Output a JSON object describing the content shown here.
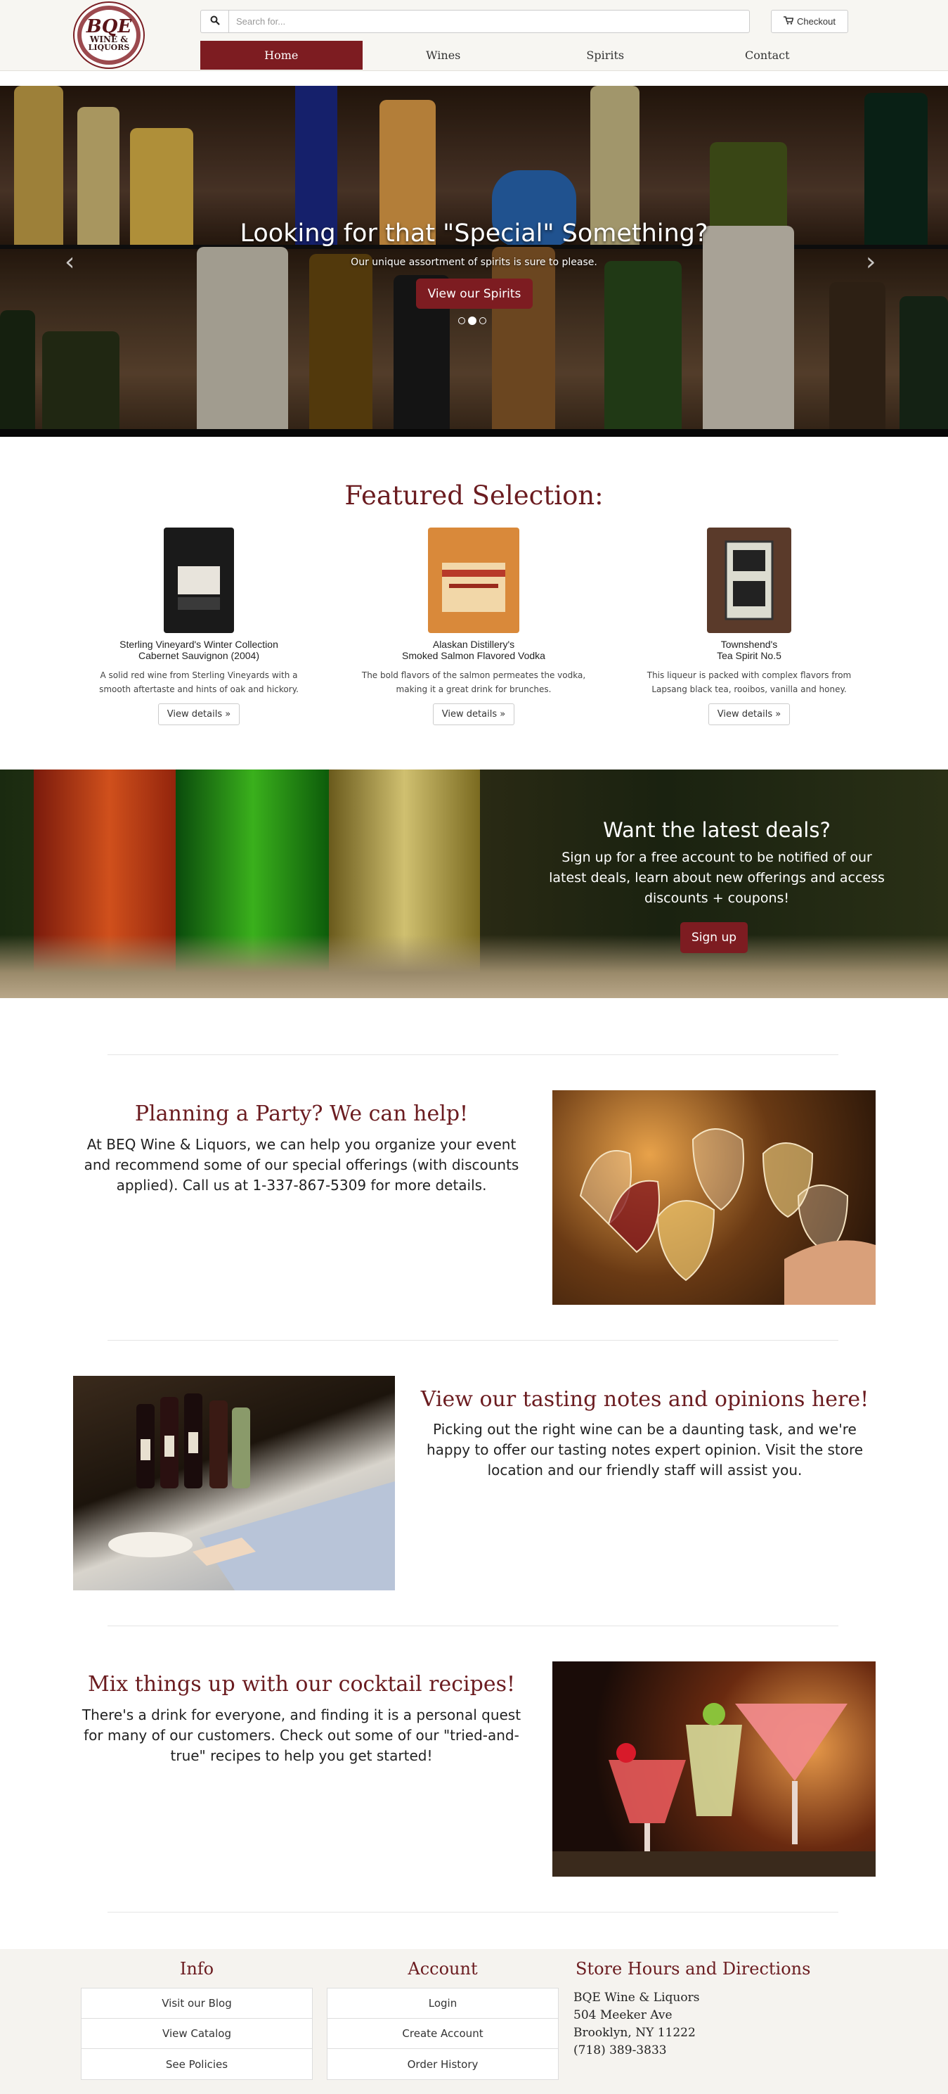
{
  "header": {
    "logo_line1": "BQE",
    "logo_line2": "WINE &",
    "logo_line3": "LIQUORS",
    "search_placeholder": "Search for...",
    "checkout_label": "Checkout"
  },
  "nav": {
    "items": [
      {
        "label": "Home",
        "active": true
      },
      {
        "label": "Wines",
        "active": false
      },
      {
        "label": "Spirits",
        "active": false
      },
      {
        "label": "Contact",
        "active": false
      }
    ]
  },
  "hero": {
    "title": "Looking for that \"Special\" Something?",
    "subtitle": "Our unique assortment of spirits is sure to please.",
    "button_label": "View our Spirits",
    "active_slide": 2,
    "slide_count": 3
  },
  "featured": {
    "title": "Featured Selection:",
    "products": [
      {
        "name_line1": "Sterling Vineyard's Winter Collection",
        "name_line2": "Cabernet Sauvignon (2004)",
        "description": "A solid red wine from Sterling Vineyards with a smooth aftertaste and hints of oak and hickory.",
        "button_label": "View details »"
      },
      {
        "name_line1": "Alaskan Distillery's",
        "name_line2": "Smoked Salmon Flavored Vodka",
        "description": "The bold flavors of the salmon permeates the vodka, making it a great drink for brunches.",
        "button_label": "View details »"
      },
      {
        "name_line1": "Townshend's",
        "name_line2": "Tea Spirit No.5",
        "description": "This liqueur is packed with complex flavors from Lapsang black tea, rooibos, vanilla and honey.",
        "button_label": "View details »"
      }
    ]
  },
  "deals": {
    "title": "Want the latest deals?",
    "text": "Sign up for a free account to be notified of our latest deals, learn about new offerings and access discounts + coupons!",
    "button_label": "Sign up"
  },
  "sections": {
    "party": {
      "title": "Planning a Party? We can help!",
      "text": "At BEQ Wine & Liquors, we can help you organize your event and recommend some of our special offerings (with discounts applied). Call us at 1-337-867-5309 for more details."
    },
    "tasting": {
      "title": "View our tasting notes and opinions here!",
      "text": "Picking out the right wine can be a daunting task, and we're happy to offer our tasting notes expert opinion. Visit the store location and our friendly staff will assist you."
    },
    "cocktail": {
      "title": "Mix things up with our cocktail recipes!",
      "text": "There's a drink for everyone, and finding it is a personal quest for many of our customers. Check out some of our \"tried-and-true\" recipes to help you get started!"
    }
  },
  "footer": {
    "info": {
      "title": "Info",
      "links": [
        "Visit our Blog",
        "View Catalog",
        "See Policies"
      ]
    },
    "account": {
      "title": "Account",
      "links": [
        "Login",
        "Create Account",
        "Order History"
      ]
    },
    "store": {
      "title": "Store Hours and Directions",
      "name": "BQE Wine & Liquors",
      "street": "504 Meeker Ave",
      "city": "Brooklyn, NY 11222",
      "phone": "(718) 389-3833"
    }
  },
  "colors": {
    "accent": "#7d1c21",
    "heading": "#6b1c20",
    "header_bg": "#f7f6f2",
    "footer_bg": "#f5f3ef"
  }
}
